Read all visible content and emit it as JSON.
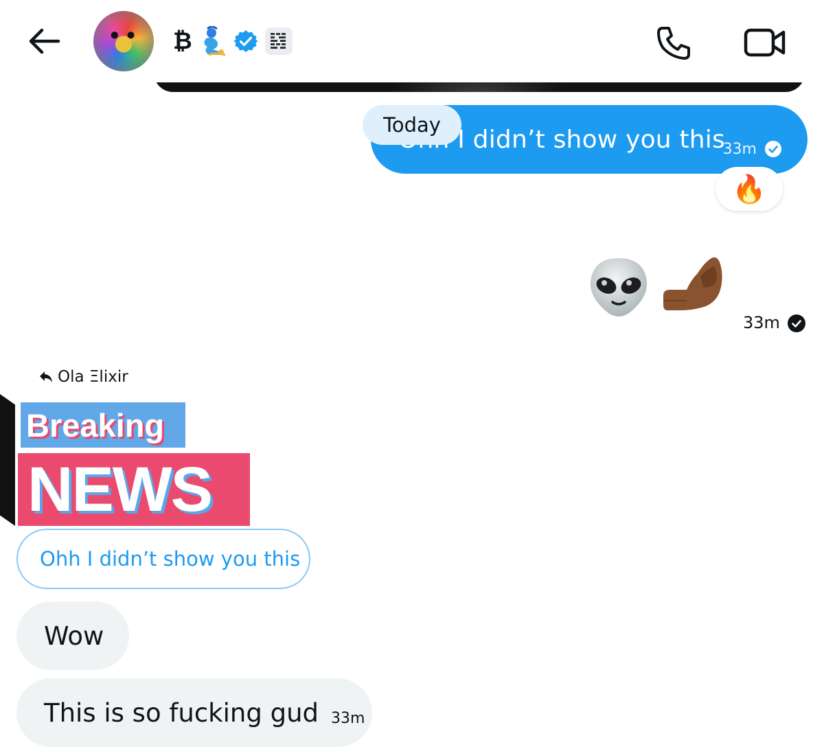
{
  "header": {
    "back_icon": "arrow-left-icon",
    "bitcoin_symbol": "₿",
    "emoji_genie": "genie-icon",
    "verified_icon": "verified-badge-icon",
    "org_badge_icon": "affiliate-badge-icon",
    "call_icon": "phone-icon",
    "video_icon": "video-camera-icon"
  },
  "conversation": {
    "date_separator": "Today",
    "sent_message": {
      "text": "Ohh I didn’t show you this",
      "time": "33m",
      "reaction": "🔥"
    },
    "emoji_message": {
      "emojis": [
        "👽",
        "🤌🏾"
      ],
      "time": "33m"
    },
    "received": {
      "replied_to": "Ola Ξlixir",
      "image_text_1": "Breaking",
      "image_text_2": "NEWS",
      "quoted_reply": "Ohh I didn’t show you this",
      "messages": [
        {
          "text": "Wow"
        },
        {
          "text": "This is so fucking gud",
          "time": "33m"
        }
      ]
    }
  },
  "colors": {
    "accent": "#1d9bf0",
    "received_bubble": "#eff3f4",
    "today_pill": "#dff0fc",
    "breaking_blue": "#62a8e8",
    "news_pink": "#ea4a6e"
  }
}
